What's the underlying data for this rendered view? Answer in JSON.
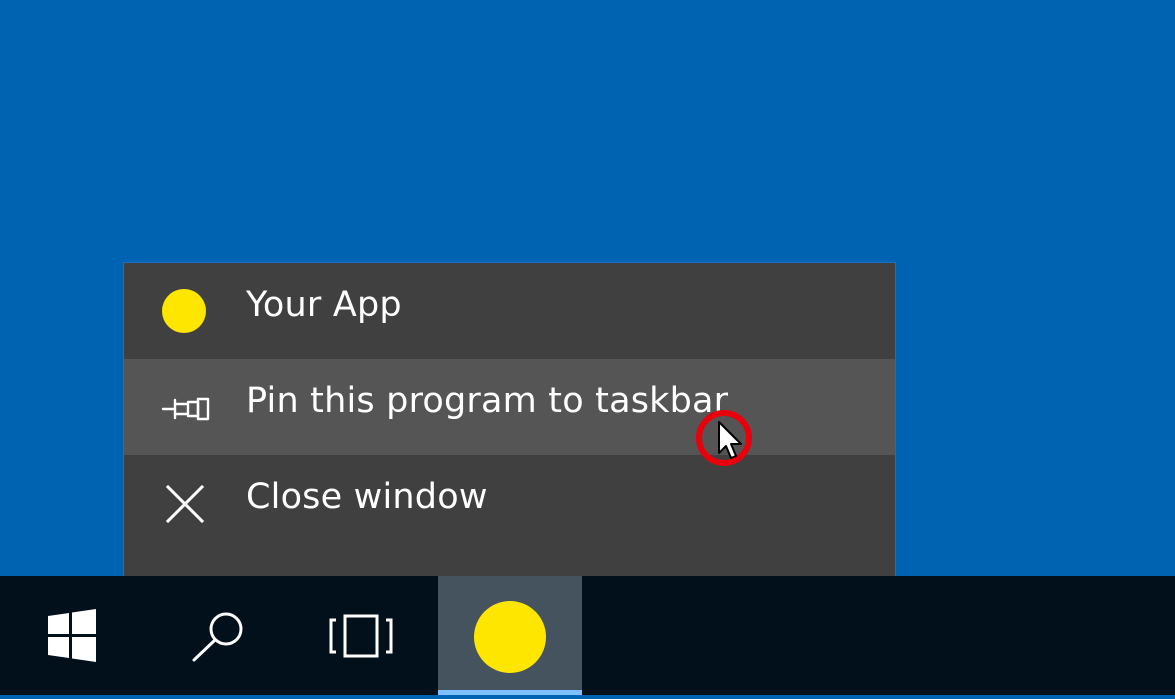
{
  "jumplist": {
    "app_title": "Your App",
    "pin_label": "Pin this program to taskbar",
    "close_label": "Close window"
  },
  "taskbar": {
    "start_icon": "windows-logo-icon",
    "search_icon": "search-icon",
    "taskview_icon": "task-view-icon",
    "app_icon": "yellow-circle-app-icon"
  },
  "colors": {
    "desktop": "#0063b1",
    "jumplist_bg": "#404040",
    "jumplist_hover": "#555555",
    "taskbar_bg": "#02101c",
    "taskbar_active": "#45535f",
    "app_yellow": "#ffe600",
    "cursor_ring": "#e8000c",
    "active_indicator": "#7fbfff"
  }
}
